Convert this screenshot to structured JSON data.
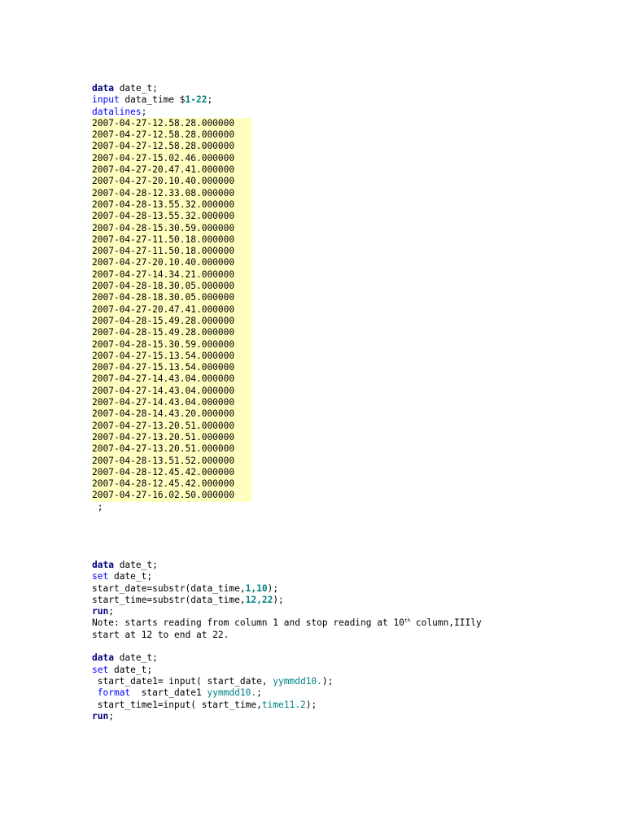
{
  "block1": {
    "kw_data": "data",
    "dataset": " date_t;",
    "kw_input": "input",
    "input_rest": " data_time $",
    "col_start": "1",
    "dash": "-",
    "col_end": "22",
    "semicolon": ";",
    "kw_datalines": "datalines",
    "datalines_end": ";",
    "rows": [
      "2007-04-27-12.58.28.000000",
      "2007-04-27-12.58.28.000000",
      "2007-04-27-12.58.28.000000",
      "2007-04-27-15.02.46.000000",
      "2007-04-27-20.47.41.000000",
      "2007-04-27-20.10.40.000000",
      "2007-04-28-12.33.08.000000",
      "2007-04-28-13.55.32.000000",
      "2007-04-28-13.55.32.000000",
      "2007-04-28-15.30.59.000000",
      "2007-04-27-11.50.18.000000",
      "2007-04-27-11.50.18.000000",
      "2007-04-27-20.10.40.000000",
      "2007-04-27-14.34.21.000000",
      "2007-04-28-18.30.05.000000",
      "2007-04-28-18.30.05.000000",
      "2007-04-27-20.47.41.000000",
      "2007-04-28-15.49.28.000000",
      "2007-04-28-15.49.28.000000",
      "2007-04-28-15.30.59.000000",
      "2007-04-27-15.13.54.000000",
      "2007-04-27-15.13.54.000000",
      "2007-04-27-14.43.04.000000",
      "2007-04-27-14.43.04.000000",
      "2007-04-27-14.43.04.000000",
      "2007-04-28-14.43.20.000000",
      "2007-04-27-13.20.51.000000",
      "2007-04-27-13.20.51.000000",
      "2007-04-27-13.20.51.000000",
      "2007-04-28-13.51.52.000000",
      "2007-04-28-12.45.42.000000",
      "2007-04-28-12.45.42.000000",
      "2007-04-27-16.02.50.000000"
    ],
    "terminator": " ;"
  },
  "block2": {
    "kw_data": "data",
    "dataset": " date_t;",
    "kw_set": "set",
    "set_rest": " date_t;",
    "start_date_pre": "start_date=substr(data_time,",
    "sd_a": "1",
    "comma": ",",
    "sd_b": "10",
    "close": ");",
    "start_time_pre": "start_time=substr(data_time,",
    "st_a": "12",
    "st_b": "22",
    "kw_run": "run",
    "run_end": ";",
    "note_pre": "Note: starts reading from column 1 and stop reading at 10",
    "note_sup": "th",
    "note_post": " column,IIIly",
    "note_line2": "start at 12 to end at 22."
  },
  "block3": {
    "kw_data": "data",
    "dataset": " date_t;",
    "kw_set": "set",
    "set_rest": " date_t;",
    "line_sd1_pre": " start_date1= input( start_date, ",
    "fmt_yymmdd": "yymmdd10.",
    "line_sd1_post": ");",
    "format_lead": " ",
    "kw_format": "format",
    "format_rest": "  start_date1 ",
    "format_end": ";",
    "line_st1_pre": " start_time1=input( start_time,",
    "fmt_time": "time11.2",
    "line_st1_post": ");",
    "kw_run": "run",
    "run_end": ";"
  }
}
